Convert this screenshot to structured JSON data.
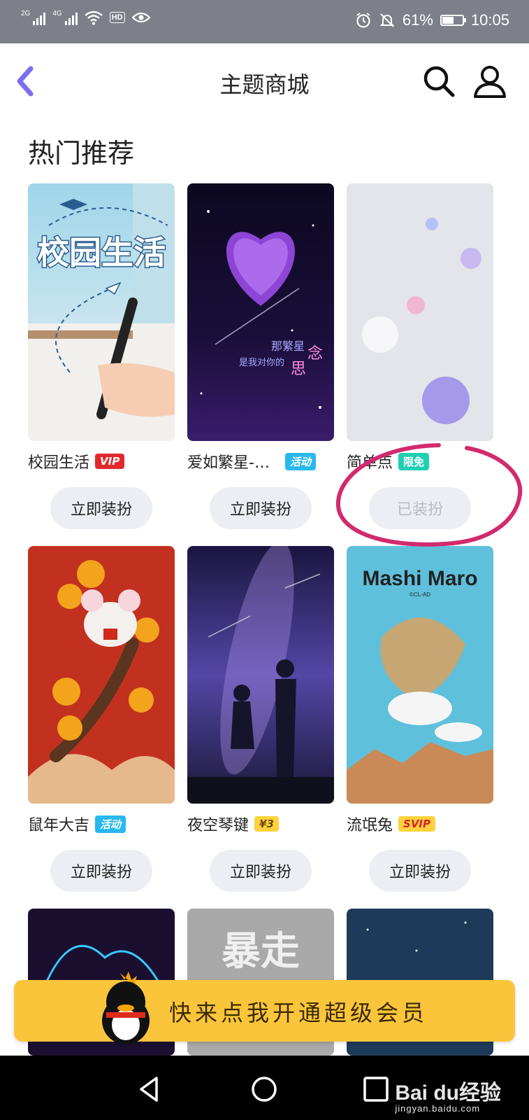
{
  "status_bar": {
    "net1": "2G",
    "net2": "4G",
    "battery_percent_text": "61%",
    "battery_level": 0.61,
    "time": "10:05"
  },
  "header": {
    "title": "主题商城",
    "icons": [
      "back-arrow-icon",
      "search-icon",
      "user-icon"
    ]
  },
  "section": {
    "title": "热门推荐"
  },
  "themes": [
    {
      "name": "校园生活",
      "badge": "VIP",
      "button": "立即装扮",
      "button_disabled": false
    },
    {
      "name": "爱如繁星-签...",
      "badge": "活动",
      "button": "立即装扮",
      "button_disabled": false
    },
    {
      "name": "简单点",
      "badge": "限免",
      "button": "已装扮",
      "button_disabled": true
    },
    {
      "name": "鼠年大吉",
      "badge": "活动",
      "button": "立即装扮",
      "button_disabled": false
    },
    {
      "name": "夜空琴键",
      "badge": "¥3",
      "button": "立即装扮",
      "button_disabled": false
    },
    {
      "name": "流氓兔",
      "badge": "SVIP",
      "button": "立即装扮",
      "button_disabled": false
    }
  ],
  "thumb_text": {
    "campus": "校园生活",
    "star_line1": "那繁星",
    "star_line2": "是我对你的",
    "star_big1": "念",
    "star_big2": "思",
    "mashimaro": "Mashi Maro",
    "mashimaro_sub": "©CL-AD",
    "bao": "暴走"
  },
  "promo": {
    "text": "快来点我开通超级会员"
  },
  "watermark": {
    "logo": "Bai du经验",
    "url": "jingyan.baidu.com"
  },
  "colors": {
    "accent": "#7b6ff0",
    "status_bar": "#7d7f89",
    "promo": "#fbc53b",
    "annotation": "#d22a6e"
  }
}
